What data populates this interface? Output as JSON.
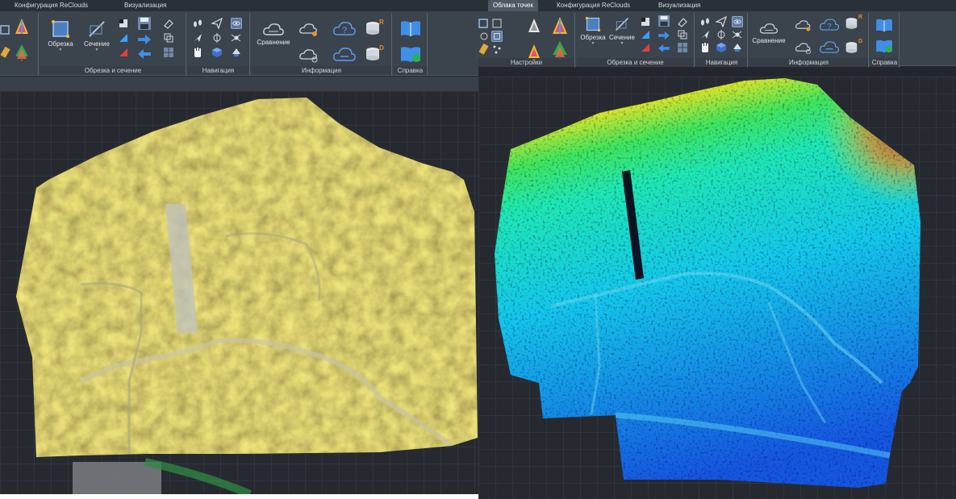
{
  "left_window": {
    "tabs": [
      "Конфигурация ReClouds",
      "Визуализация"
    ],
    "groups": {
      "clip": "Обрезка и сечение",
      "nav": "Навигация",
      "info": "Информация",
      "help": "Справка"
    },
    "tools": {
      "obrezka": "Обрезка",
      "sechenie": "Сечение",
      "sravnenie": "Сравнение"
    }
  },
  "right_window": {
    "tabs": [
      "Облака точек",
      "Конфигурация ReClouds",
      "Визуализация"
    ],
    "active_tab_index": 0,
    "groups": {
      "settings": "Настройки",
      "clip": "Обрезка и сечение",
      "nav": "Навигация",
      "info": "Информация",
      "help": "Справка"
    },
    "tools": {
      "obrezka": "Обрезка",
      "sechenie": "Сечение",
      "sravnenie": "Сравнение"
    },
    "badges": {
      "r": "R",
      "d": "D"
    }
  },
  "views": {
    "left_mode": "rgb-point-cloud",
    "right_mode": "elevation-colormap",
    "elevation_colormap": [
      "#1556e0",
      "#1a8ff0",
      "#14c8ea",
      "#1fe8b4",
      "#41e65a",
      "#d9e52a",
      "#f08a1c",
      "#e02a16"
    ]
  }
}
